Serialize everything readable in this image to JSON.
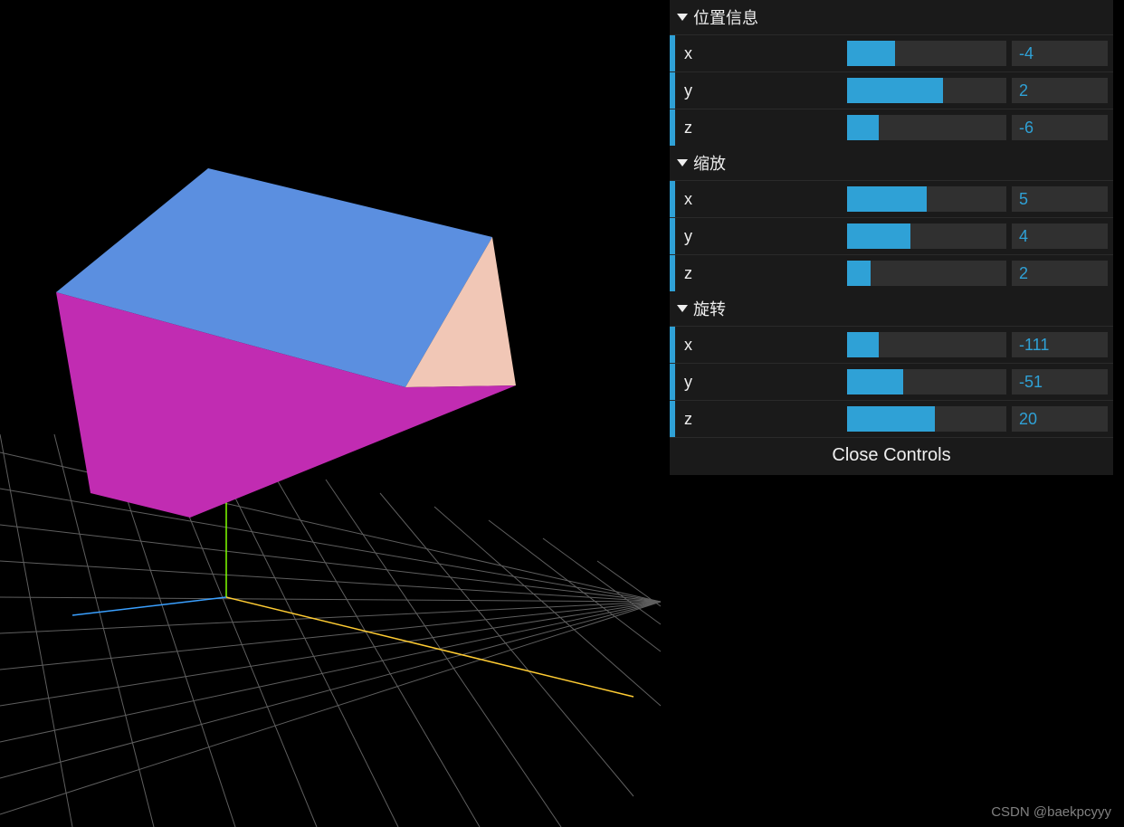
{
  "gui": {
    "folders": [
      {
        "id": "position",
        "title": "位置信息",
        "controls": [
          {
            "id": "pos-x",
            "label": "x",
            "value": -4,
            "fill_pct": 30
          },
          {
            "id": "pos-y",
            "label": "y",
            "value": 2,
            "fill_pct": 60
          },
          {
            "id": "pos-z",
            "label": "z",
            "value": -6,
            "fill_pct": 20
          }
        ]
      },
      {
        "id": "scale",
        "title": "缩放",
        "controls": [
          {
            "id": "scale-x",
            "label": "x",
            "value": 5,
            "fill_pct": 50
          },
          {
            "id": "scale-y",
            "label": "y",
            "value": 4,
            "fill_pct": 40
          },
          {
            "id": "scale-z",
            "label": "z",
            "value": 2,
            "fill_pct": 15
          }
        ]
      },
      {
        "id": "rotation",
        "title": "旋转",
        "controls": [
          {
            "id": "rot-x",
            "label": "x",
            "value": -111,
            "fill_pct": 20
          },
          {
            "id": "rot-y",
            "label": "y",
            "value": -51,
            "fill_pct": 35
          },
          {
            "id": "rot-z",
            "label": "z",
            "value": 20,
            "fill_pct": 55
          }
        ]
      }
    ],
    "close_label": "Close Controls"
  },
  "watermark": "CSDN @baekpcyyy",
  "colors": {
    "accent": "#2fa1d6",
    "cube_top": "#5b8fe0",
    "cube_front": "#c12cb2",
    "cube_side": "#f1c7b6"
  }
}
